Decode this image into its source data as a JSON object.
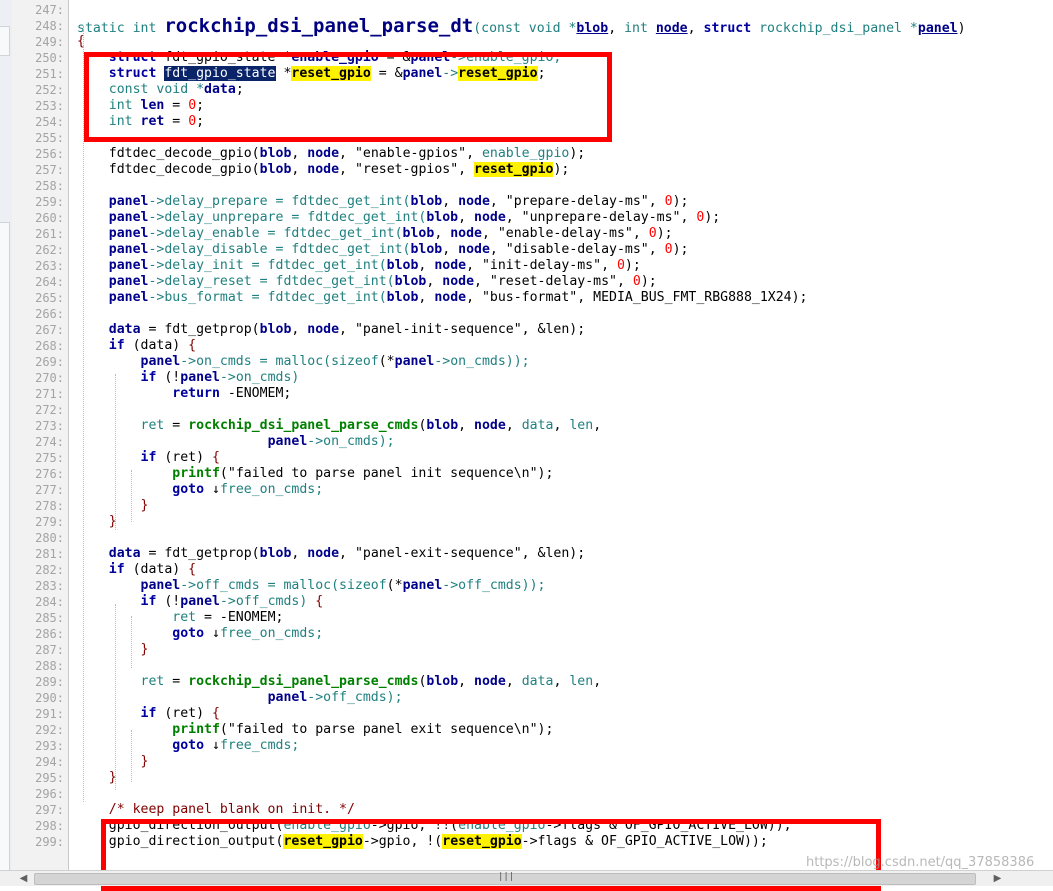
{
  "editor": {
    "line_numbers": [
      "247:",
      "248:",
      "249:",
      "250:",
      "251:",
      "252:",
      "253:",
      "254:",
      "255:",
      "256:",
      "257:",
      "258:",
      "259:",
      "260:",
      "261:",
      "262:",
      "263:",
      "264:",
      "265:",
      "266:",
      "267:",
      "268:",
      "269:",
      "270:",
      "271:",
      "272:",
      "273:",
      "274:",
      "275:",
      "276:",
      "277:",
      "278:",
      "279:",
      "280:",
      "281:",
      "282:",
      "283:",
      "284:",
      "285:",
      "286:",
      "287:",
      "288:",
      "289:",
      "290:",
      "291:",
      "292:",
      "293:",
      "294:",
      "295:",
      "296:",
      "297:",
      "298:",
      "299:"
    ],
    "code_lines": [
      [],
      [
        [
          "static int ",
          "ty"
        ],
        [
          "rockchip_dsi_panel_parse_dt",
          "fnbig"
        ],
        [
          "(const void *",
          "ty"
        ],
        [
          "blob",
          "ul"
        ],
        [
          ", ",
          "t"
        ],
        [
          "int ",
          "ty"
        ],
        [
          "node",
          "ul"
        ],
        [
          ", ",
          "t"
        ],
        [
          "struct ",
          "k"
        ],
        [
          "rockchip_dsi_panel *",
          "ty"
        ],
        [
          "panel",
          "ul"
        ],
        [
          ")",
          "t"
        ]
      ],
      [
        [
          "{",
          "brace"
        ]
      ],
      [
        [
          "    ",
          "t"
        ],
        [
          "struct ",
          "k"
        ],
        [
          "fdt_gpio_state *",
          "t"
        ],
        [
          "enable_gpio",
          "b"
        ],
        [
          " = &",
          "t"
        ],
        [
          "panel",
          "b"
        ],
        [
          "->enable_gpio;",
          "ty"
        ]
      ],
      [
        [
          "    ",
          "t"
        ],
        [
          "struct ",
          "k"
        ],
        [
          "fdt_gpio_state",
          "sel"
        ],
        [
          " *",
          "t"
        ],
        [
          "reset_gpio",
          "hl"
        ],
        [
          " = &",
          "t"
        ],
        [
          "panel",
          "b"
        ],
        [
          "->",
          "ty"
        ],
        [
          "reset_gpio",
          "hl"
        ],
        [
          ";",
          "t"
        ]
      ],
      [
        [
          "    ",
          "t"
        ],
        [
          "const void *",
          "ty"
        ],
        [
          "data",
          "b"
        ],
        [
          ";",
          "t"
        ]
      ],
      [
        [
          "    ",
          "t"
        ],
        [
          "int ",
          "ty"
        ],
        [
          "len",
          "b"
        ],
        [
          " = ",
          "t"
        ],
        [
          "0",
          "num"
        ],
        [
          ";",
          "t"
        ]
      ],
      [
        [
          "    ",
          "t"
        ],
        [
          "int ",
          "ty"
        ],
        [
          "ret",
          "b"
        ],
        [
          " = ",
          "t"
        ],
        [
          "0",
          "num"
        ],
        [
          ";",
          "t"
        ]
      ],
      [],
      [
        [
          "    fdtdec_decode_gpio(",
          "t"
        ],
        [
          "blob",
          "b"
        ],
        [
          ", ",
          "t"
        ],
        [
          "node",
          "b"
        ],
        [
          ", ",
          "t"
        ],
        [
          "\"enable-gpios\"",
          "strq"
        ],
        [
          ", ",
          "t"
        ],
        [
          "enable_gpio",
          "ty"
        ],
        [
          ");",
          "t"
        ]
      ],
      [
        [
          "    fdtdec_decode_gpio(",
          "t"
        ],
        [
          "blob",
          "b"
        ],
        [
          ", ",
          "t"
        ],
        [
          "node",
          "b"
        ],
        [
          ", ",
          "t"
        ],
        [
          "\"reset-gpios\"",
          "strq"
        ],
        [
          ", ",
          "t"
        ],
        [
          "reset_gpio",
          "hl"
        ],
        [
          ");",
          "t"
        ]
      ],
      [],
      [
        [
          "    ",
          "t"
        ],
        [
          "panel",
          "b"
        ],
        [
          "->delay_prepare = fdtdec_get_int(",
          "ty"
        ],
        [
          "blob",
          "b"
        ],
        [
          ", ",
          "t"
        ],
        [
          "node",
          "b"
        ],
        [
          ", ",
          "t"
        ],
        [
          "\"prepare-delay-ms\"",
          "strq"
        ],
        [
          ", ",
          "t"
        ],
        [
          "0",
          "num"
        ],
        [
          ");",
          "t"
        ]
      ],
      [
        [
          "    ",
          "t"
        ],
        [
          "panel",
          "b"
        ],
        [
          "->delay_unprepare = fdtdec_get_int(",
          "ty"
        ],
        [
          "blob",
          "b"
        ],
        [
          ", ",
          "t"
        ],
        [
          "node",
          "b"
        ],
        [
          ", ",
          "t"
        ],
        [
          "\"unprepare-delay-ms\"",
          "strq"
        ],
        [
          ", ",
          "t"
        ],
        [
          "0",
          "num"
        ],
        [
          ");",
          "t"
        ]
      ],
      [
        [
          "    ",
          "t"
        ],
        [
          "panel",
          "b"
        ],
        [
          "->delay_enable = fdtdec_get_int(",
          "ty"
        ],
        [
          "blob",
          "b"
        ],
        [
          ", ",
          "t"
        ],
        [
          "node",
          "b"
        ],
        [
          ", ",
          "t"
        ],
        [
          "\"enable-delay-ms\"",
          "strq"
        ],
        [
          ", ",
          "t"
        ],
        [
          "0",
          "num"
        ],
        [
          ");",
          "t"
        ]
      ],
      [
        [
          "    ",
          "t"
        ],
        [
          "panel",
          "b"
        ],
        [
          "->delay_disable = fdtdec_get_int(",
          "ty"
        ],
        [
          "blob",
          "b"
        ],
        [
          ", ",
          "t"
        ],
        [
          "node",
          "b"
        ],
        [
          ", ",
          "t"
        ],
        [
          "\"disable-delay-ms\"",
          "strq"
        ],
        [
          ", ",
          "t"
        ],
        [
          "0",
          "num"
        ],
        [
          ");",
          "t"
        ]
      ],
      [
        [
          "    ",
          "t"
        ],
        [
          "panel",
          "b"
        ],
        [
          "->delay_init = fdtdec_get_int(",
          "ty"
        ],
        [
          "blob",
          "b"
        ],
        [
          ", ",
          "t"
        ],
        [
          "node",
          "b"
        ],
        [
          ", ",
          "t"
        ],
        [
          "\"init-delay-ms\"",
          "strq"
        ],
        [
          ", ",
          "t"
        ],
        [
          "0",
          "num"
        ],
        [
          ");",
          "t"
        ]
      ],
      [
        [
          "    ",
          "t"
        ],
        [
          "panel",
          "b"
        ],
        [
          "->delay_reset = fdtdec_get_int(",
          "ty"
        ],
        [
          "blob",
          "b"
        ],
        [
          ", ",
          "t"
        ],
        [
          "node",
          "b"
        ],
        [
          ", ",
          "t"
        ],
        [
          "\"reset-delay-ms\"",
          "strq"
        ],
        [
          ", ",
          "t"
        ],
        [
          "0",
          "num"
        ],
        [
          ");",
          "t"
        ]
      ],
      [
        [
          "    ",
          "t"
        ],
        [
          "panel",
          "b"
        ],
        [
          "->bus_format = fdtdec_get_int(",
          "ty"
        ],
        [
          "blob",
          "b"
        ],
        [
          ", ",
          "t"
        ],
        [
          "node",
          "b"
        ],
        [
          ", ",
          "t"
        ],
        [
          "\"bus-format\"",
          "strq"
        ],
        [
          ", MEDIA_BUS_FMT_RBG888_1X24);",
          "t"
        ]
      ],
      [],
      [
        [
          "    ",
          "t"
        ],
        [
          "data",
          "b"
        ],
        [
          " = fdt_getprop(",
          "t"
        ],
        [
          "blob",
          "b"
        ],
        [
          ", ",
          "t"
        ],
        [
          "node",
          "b"
        ],
        [
          ", ",
          "t"
        ],
        [
          "\"panel-init-sequence\"",
          "strq"
        ],
        [
          ", &len);",
          "t"
        ]
      ],
      [
        [
          "    ",
          "t"
        ],
        [
          "if ",
          "k"
        ],
        [
          "(data) ",
          "t"
        ],
        [
          "{",
          "brace"
        ]
      ],
      [
        [
          "        ",
          "t"
        ],
        [
          "panel",
          "b"
        ],
        [
          "->on_cmds = malloc(",
          "ty"
        ],
        [
          "sizeof",
          "ty"
        ],
        [
          "(*",
          "t"
        ],
        [
          "panel",
          "b"
        ],
        [
          "->on_cmds));",
          "ty"
        ]
      ],
      [
        [
          "        ",
          "t"
        ],
        [
          "if ",
          "k"
        ],
        [
          "(!",
          "t"
        ],
        [
          "panel",
          "b"
        ],
        [
          "->on_cmds)",
          "ty"
        ]
      ],
      [
        [
          "            ",
          "t"
        ],
        [
          "return ",
          "k"
        ],
        [
          "-ENOMEM;",
          "t"
        ]
      ],
      [],
      [
        [
          "        ",
          "t"
        ],
        [
          "ret",
          "ty"
        ],
        [
          " = ",
          "t"
        ],
        [
          "rockchip_dsi_panel_parse_cmds",
          "gr"
        ],
        [
          "(",
          "t"
        ],
        [
          "blob",
          "b"
        ],
        [
          ", ",
          "t"
        ],
        [
          "node",
          "b"
        ],
        [
          ", ",
          "t"
        ],
        [
          "data",
          "ty"
        ],
        [
          ", ",
          "t"
        ],
        [
          "len",
          "ty"
        ],
        [
          ",",
          "t"
        ]
      ],
      [
        [
          "                        ",
          "t"
        ],
        [
          "panel",
          "b"
        ],
        [
          "->on_cmds);",
          "ty"
        ]
      ],
      [
        [
          "        ",
          "t"
        ],
        [
          "if ",
          "k"
        ],
        [
          "(ret) ",
          "t"
        ],
        [
          "{",
          "brace"
        ]
      ],
      [
        [
          "            ",
          "t"
        ],
        [
          "printf",
          "gr"
        ],
        [
          "(",
          "t"
        ],
        [
          "\"failed to parse panel init sequence\\n\"",
          "strq"
        ],
        [
          ");",
          "t"
        ]
      ],
      [
        [
          "            ",
          "t"
        ],
        [
          "goto ",
          "k"
        ],
        [
          "↓",
          "t"
        ],
        [
          "free_on_cmds;",
          "ty"
        ]
      ],
      [
        [
          "        ",
          "t"
        ],
        [
          "}",
          "brace"
        ]
      ],
      [
        [
          "    ",
          "t"
        ],
        [
          "}",
          "brace"
        ]
      ],
      [],
      [
        [
          "    ",
          "t"
        ],
        [
          "data",
          "b"
        ],
        [
          " = fdt_getprop(",
          "t"
        ],
        [
          "blob",
          "b"
        ],
        [
          ", ",
          "t"
        ],
        [
          "node",
          "b"
        ],
        [
          ", ",
          "t"
        ],
        [
          "\"panel-exit-sequence\"",
          "strq"
        ],
        [
          ", &len);",
          "t"
        ]
      ],
      [
        [
          "    ",
          "t"
        ],
        [
          "if ",
          "k"
        ],
        [
          "(data) ",
          "t"
        ],
        [
          "{",
          "brace"
        ]
      ],
      [
        [
          "        ",
          "t"
        ],
        [
          "panel",
          "b"
        ],
        [
          "->off_cmds = malloc(",
          "ty"
        ],
        [
          "sizeof",
          "ty"
        ],
        [
          "(*",
          "t"
        ],
        [
          "panel",
          "b"
        ],
        [
          "->off_cmds));",
          "ty"
        ]
      ],
      [
        [
          "        ",
          "t"
        ],
        [
          "if ",
          "k"
        ],
        [
          "(!",
          "t"
        ],
        [
          "panel",
          "b"
        ],
        [
          "->off_cmds) ",
          "ty"
        ],
        [
          "{",
          "brace"
        ]
      ],
      [
        [
          "            ",
          "t"
        ],
        [
          "ret",
          "ty"
        ],
        [
          " = -ENOMEM;",
          "t"
        ]
      ],
      [
        [
          "            ",
          "t"
        ],
        [
          "goto ",
          "k"
        ],
        [
          "↓",
          "t"
        ],
        [
          "free_on_cmds;",
          "ty"
        ]
      ],
      [
        [
          "        ",
          "t"
        ],
        [
          "}",
          "brace"
        ]
      ],
      [],
      [
        [
          "        ",
          "t"
        ],
        [
          "ret",
          "ty"
        ],
        [
          " = ",
          "t"
        ],
        [
          "rockchip_dsi_panel_parse_cmds",
          "gr"
        ],
        [
          "(",
          "t"
        ],
        [
          "blob",
          "b"
        ],
        [
          ", ",
          "t"
        ],
        [
          "node",
          "b"
        ],
        [
          ", ",
          "t"
        ],
        [
          "data",
          "ty"
        ],
        [
          ", ",
          "t"
        ],
        [
          "len",
          "ty"
        ],
        [
          ",",
          "t"
        ]
      ],
      [
        [
          "                        ",
          "t"
        ],
        [
          "panel",
          "b"
        ],
        [
          "->off_cmds);",
          "ty"
        ]
      ],
      [
        [
          "        ",
          "t"
        ],
        [
          "if ",
          "k"
        ],
        [
          "(ret) ",
          "t"
        ],
        [
          "{",
          "brace"
        ]
      ],
      [
        [
          "            ",
          "t"
        ],
        [
          "printf",
          "gr"
        ],
        [
          "(",
          "t"
        ],
        [
          "\"failed to parse panel exit sequence\\n\"",
          "strq"
        ],
        [
          ");",
          "t"
        ]
      ],
      [
        [
          "            ",
          "t"
        ],
        [
          "goto ",
          "k"
        ],
        [
          "↓",
          "t"
        ],
        [
          "free_cmds;",
          "ty"
        ]
      ],
      [
        [
          "        ",
          "t"
        ],
        [
          "}",
          "brace"
        ]
      ],
      [
        [
          "    ",
          "t"
        ],
        [
          "}",
          "brace"
        ]
      ],
      [],
      [
        [
          "    ",
          "t"
        ],
        [
          "/* keep panel blank on init. */",
          "cm"
        ]
      ],
      [
        [
          "    gpio_direction_output(",
          "t"
        ],
        [
          "enable_gpio",
          "ty"
        ],
        [
          "->gpio, !!(",
          "t"
        ],
        [
          "enable_gpio",
          "ty"
        ],
        [
          "->flags & OF_GPIO_ACTIVE_LOW));",
          "t"
        ]
      ],
      [
        [
          "    gpio_direction_output(",
          "t"
        ],
        [
          "reset_gpio",
          "hl"
        ],
        [
          "->gpio, !(",
          "t"
        ],
        [
          "reset_gpio",
          "hl"
        ],
        [
          "->flags & OF_GPIO_ACTIVE_LOW));",
          "t"
        ]
      ]
    ]
  },
  "watermark": "https://blog.csdn.net/qq_37858386",
  "scrollbar": {
    "left_arrow": "◀",
    "right_arrow": "▶",
    "grip": "|||"
  },
  "colors": {
    "highlight": "#fff200",
    "selection": "#0a246a",
    "annotation_box": "#ff0000"
  }
}
